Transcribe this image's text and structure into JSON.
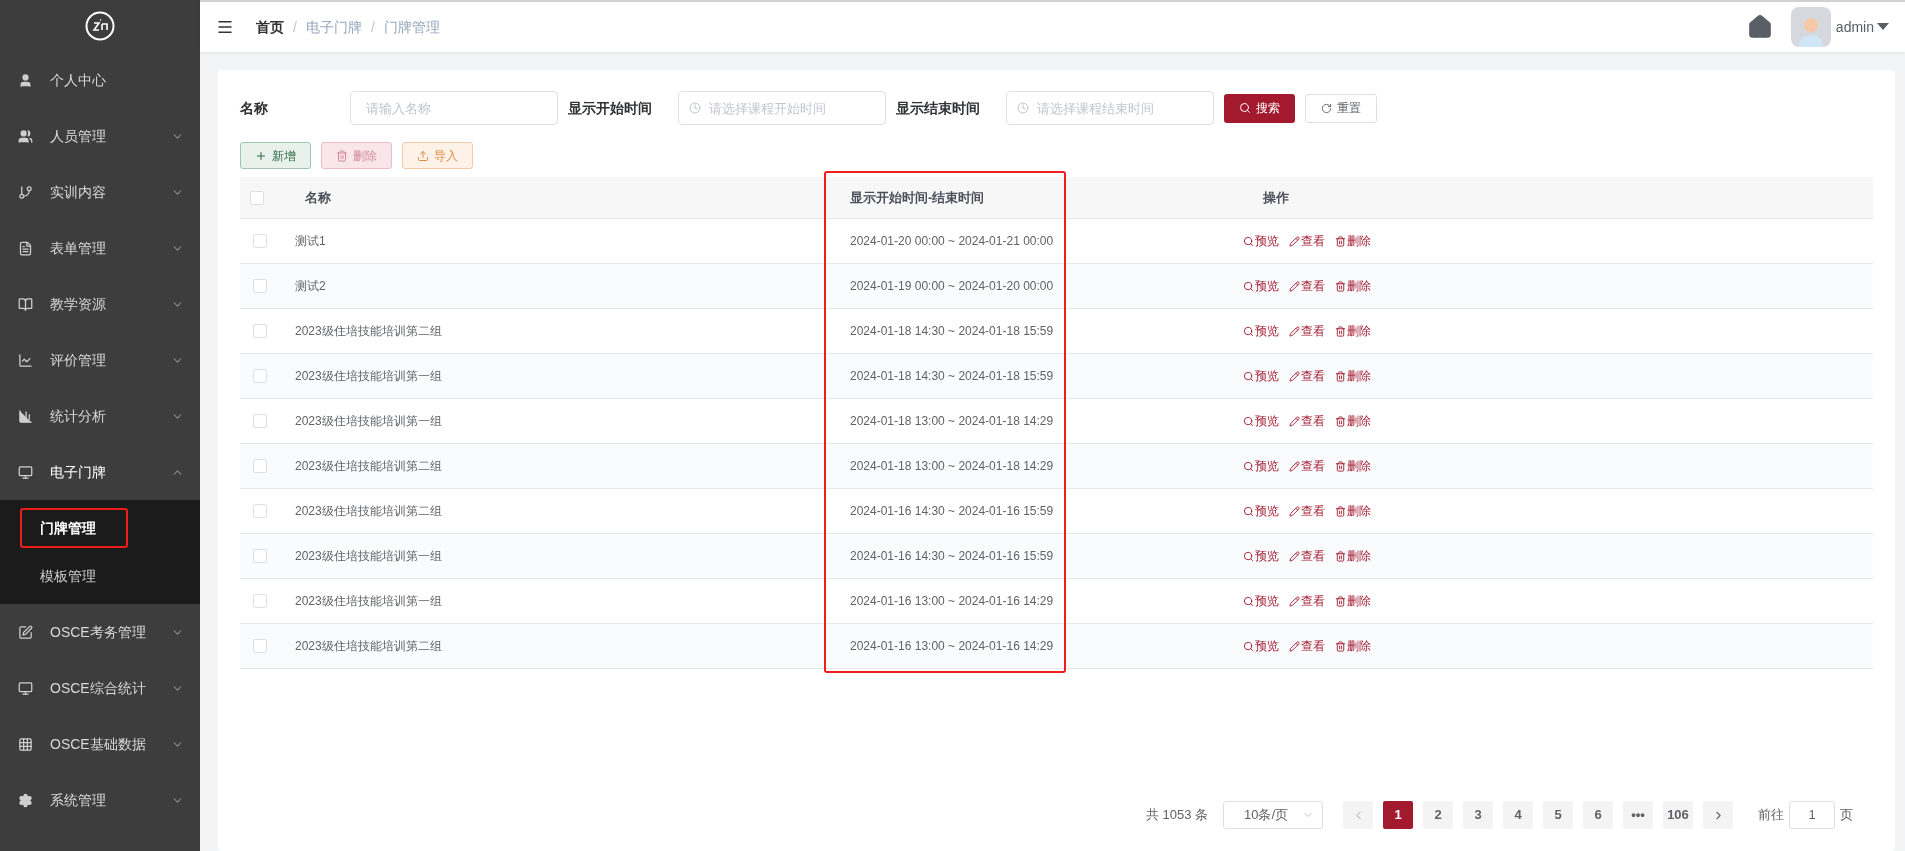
{
  "sidebar": {
    "items": [
      {
        "label": "个人中心"
      },
      {
        "label": "人员管理",
        "expanded": false
      },
      {
        "label": "实训内容",
        "expanded": false
      },
      {
        "label": "表单管理",
        "expanded": false
      },
      {
        "label": "教学资源",
        "expanded": false
      },
      {
        "label": "评价管理",
        "expanded": false
      },
      {
        "label": "统计分析",
        "expanded": false
      },
      {
        "label": "电子门牌",
        "expanded": true,
        "children": [
          {
            "label": "门牌管理",
            "selected": true,
            "highlighted": true
          },
          {
            "label": "模板管理",
            "selected": false
          }
        ]
      },
      {
        "label": "OSCE考务管理",
        "expanded": false
      },
      {
        "label": "OSCE综合统计",
        "expanded": false
      },
      {
        "label": "OSCE基础数据",
        "expanded": false
      },
      {
        "label": "系统管理",
        "expanded": false
      }
    ]
  },
  "breadcrumb": [
    {
      "label": "首页"
    },
    {
      "separator": "/",
      "label": "电子门牌"
    },
    {
      "separator": "/",
      "label": "门牌管理"
    }
  ],
  "user": {
    "name": "admin"
  },
  "filters": [
    {
      "label": "名称",
      "placeholder": "请输入名称",
      "kind": "text"
    },
    {
      "label": "显示开始时间",
      "placeholder": "请选择课程开始时间",
      "kind": "time"
    },
    {
      "label": "显示结束时间",
      "placeholder": "请选择课程结束时间",
      "kind": "time"
    }
  ],
  "search_button": "搜索",
  "reset_button": "重置",
  "actions": [
    {
      "label": "新增",
      "kind": "add"
    },
    {
      "label": "删除",
      "kind": "delete"
    },
    {
      "label": "导入",
      "kind": "import"
    }
  ],
  "table": {
    "select_all_checked": false,
    "columns": [
      {
        "label": "名称"
      },
      {
        "label": "显示开始时间-结束时间",
        "highlighted": true
      },
      {
        "label": "操作"
      }
    ],
    "rows": [
      {
        "name": "测试1",
        "time": "2024-01-20 00:00 ~ 2024-01-21 00:00",
        "checked": false,
        "actions": [
          {
            "label": "预览",
            "kind": "preview"
          },
          {
            "label": "查看",
            "kind": "edit"
          },
          {
            "label": "删除",
            "kind": "delete"
          }
        ]
      },
      {
        "name": "测试2",
        "time": "2024-01-19 00:00 ~ 2024-01-20 00:00",
        "checked": false,
        "actions": [
          {
            "label": "预览",
            "kind": "preview"
          },
          {
            "label": "查看",
            "kind": "edit"
          },
          {
            "label": "删除",
            "kind": "delete"
          }
        ]
      },
      {
        "name": "2023级住培技能培训第二组",
        "time": "2024-01-18 14:30 ~ 2024-01-18 15:59",
        "checked": false,
        "actions": [
          {
            "label": "预览",
            "kind": "preview"
          },
          {
            "label": "查看",
            "kind": "edit"
          },
          {
            "label": "删除",
            "kind": "delete"
          }
        ]
      },
      {
        "name": "2023级住培技能培训第一组",
        "time": "2024-01-18 14:30 ~ 2024-01-18 15:59",
        "checked": false,
        "actions": [
          {
            "label": "预览",
            "kind": "preview"
          },
          {
            "label": "查看",
            "kind": "edit"
          },
          {
            "label": "删除",
            "kind": "delete"
          }
        ]
      },
      {
        "name": "2023级住培技能培训第一组",
        "time": "2024-01-18 13:00 ~ 2024-01-18 14:29",
        "checked": false,
        "actions": [
          {
            "label": "预览",
            "kind": "preview"
          },
          {
            "label": "查看",
            "kind": "edit"
          },
          {
            "label": "删除",
            "kind": "delete"
          }
        ]
      },
      {
        "name": "2023级住培技能培训第二组",
        "time": "2024-01-18 13:00 ~ 2024-01-18 14:29",
        "checked": false,
        "actions": [
          {
            "label": "预览",
            "kind": "preview"
          },
          {
            "label": "查看",
            "kind": "edit"
          },
          {
            "label": "删除",
            "kind": "delete"
          }
        ]
      },
      {
        "name": "2023级住培技能培训第二组",
        "time": "2024-01-16 14:30 ~ 2024-01-16 15:59",
        "checked": false,
        "actions": [
          {
            "label": "预览",
            "kind": "preview"
          },
          {
            "label": "查看",
            "kind": "edit"
          },
          {
            "label": "删除",
            "kind": "delete"
          }
        ]
      },
      {
        "name": "2023级住培技能培训第一组",
        "time": "2024-01-16 14:30 ~ 2024-01-16 15:59",
        "checked": false,
        "actions": [
          {
            "label": "预览",
            "kind": "preview"
          },
          {
            "label": "查看",
            "kind": "edit"
          },
          {
            "label": "删除",
            "kind": "delete"
          }
        ]
      },
      {
        "name": "2023级住培技能培训第一组",
        "time": "2024-01-16 13:00 ~ 2024-01-16 14:29",
        "checked": false,
        "actions": [
          {
            "label": "预览",
            "kind": "preview"
          },
          {
            "label": "查看",
            "kind": "edit"
          },
          {
            "label": "删除",
            "kind": "delete"
          }
        ]
      },
      {
        "name": "2023级住培技能培训第二组",
        "time": "2024-01-16 13:00 ~ 2024-01-16 14:29",
        "checked": false,
        "actions": [
          {
            "label": "预览",
            "kind": "preview"
          },
          {
            "label": "查看",
            "kind": "edit"
          },
          {
            "label": "删除",
            "kind": "delete"
          }
        ]
      }
    ]
  },
  "pagination": {
    "total": "共 1053 条",
    "page_size": "10条/页",
    "pages": [
      {
        "label": "1",
        "selected": true
      },
      {
        "label": "2",
        "selected": false
      },
      {
        "label": "3",
        "selected": false
      },
      {
        "label": "4",
        "selected": false
      },
      {
        "label": "5",
        "selected": false
      },
      {
        "label": "6",
        "selected": false
      },
      {
        "label": "•••",
        "selected": false
      },
      {
        "label": "106",
        "selected": false
      }
    ],
    "goto_label": "前往",
    "goto_value": "1",
    "goto_suffix": "页"
  }
}
